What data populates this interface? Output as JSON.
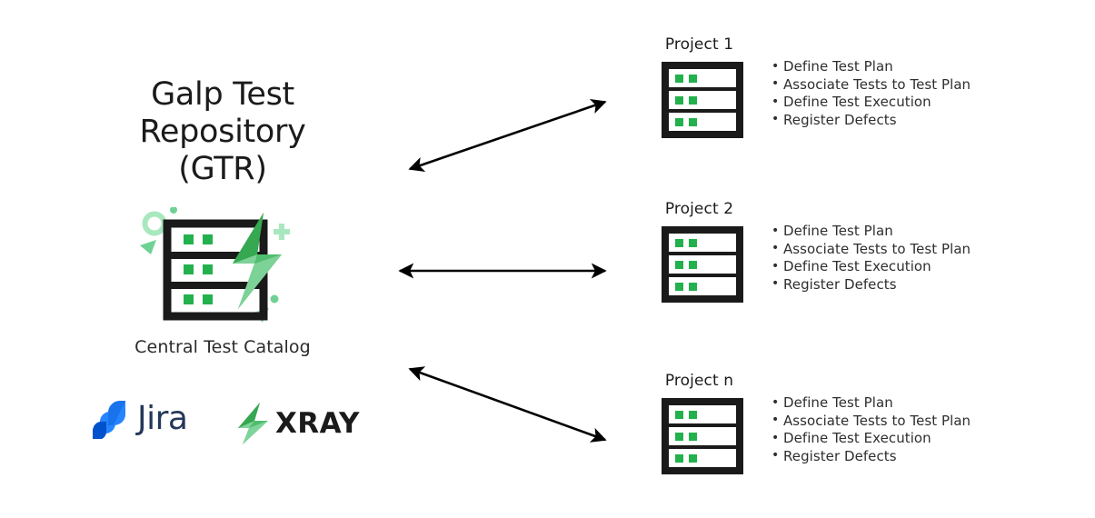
{
  "repository": {
    "title_lines": [
      "Galp Test",
      "Repository",
      "(GTR)"
    ],
    "catalog_label": "Central Test Catalog",
    "icon_name": "central-test-catalog-icon"
  },
  "logos": [
    {
      "name": "jira-logo",
      "wordmark": "Jira",
      "mark_colors": [
        "#2684FF",
        "#0052CC"
      ],
      "text_color": "#253858"
    },
    {
      "name": "xray-logo",
      "wordmark": "XRAY",
      "mark_colors": [
        "#36B25A",
        "#7FD49A"
      ],
      "text_color": "#1b1b1b"
    }
  ],
  "colors": {
    "green_accent": "#22B14C",
    "green_light": "#7FD49A",
    "green_pale": "#A9E8BF",
    "dark": "#1A1A1A",
    "text": "#2e2e2e"
  },
  "projects": [
    {
      "title": "Project 1",
      "icon_name": "project-server-icon",
      "tasks": [
        "Define Test Plan",
        "Associate Tests to Test Plan",
        "Define Test Execution",
        "Register Defects"
      ]
    },
    {
      "title": "Project 2",
      "icon_name": "project-server-icon",
      "tasks": [
        "Define Test Plan",
        "Associate Tests to Test Plan",
        "Define Test Execution",
        "Register Defects"
      ]
    },
    {
      "title": "Project n",
      "icon_name": "project-server-icon",
      "tasks": [
        "Define Test Plan",
        "Associate Tests to Test Plan",
        "Define Test Execution",
        "Register Defects"
      ]
    }
  ],
  "connectors": [
    {
      "name": "connector-gtr-to-project-1",
      "style": "double-headed-arrow",
      "direction": "up-right"
    },
    {
      "name": "connector-gtr-to-project-2",
      "style": "double-headed-arrow",
      "direction": "horizontal"
    },
    {
      "name": "connector-gtr-to-project-n",
      "style": "double-headed-arrow",
      "direction": "down-right"
    }
  ]
}
